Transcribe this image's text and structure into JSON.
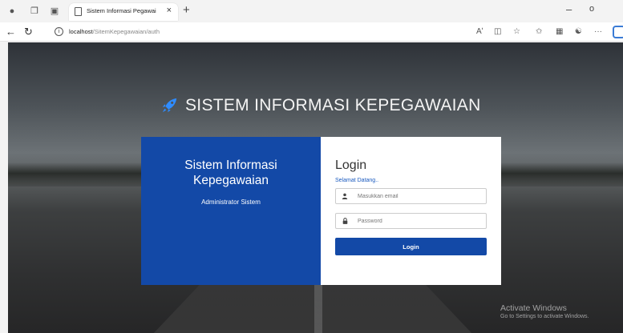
{
  "browser": {
    "tab_title": "Sistem Informasi Pegawai",
    "tab_close": "×",
    "new_tab": "+",
    "url_host": "localhost",
    "url_path": "/SitemKepegawaian/auth",
    "window_minimize": "–",
    "window_maximize": "o",
    "toolbar_more": "···",
    "read_aloud": "Aʹ"
  },
  "page": {
    "heading": "SISTEM INFORMASI KEPEGAWAIAN",
    "left_panel": {
      "title_line1": "Sistem Informasi",
      "title_line2": "Kepegawaian",
      "subtitle": "Administrator Sistem"
    },
    "login": {
      "title": "Login",
      "welcome": "Selamat Datang..",
      "email_placeholder": "Masukkan email",
      "password_placeholder": "Password",
      "button_label": "Login"
    },
    "accent_color": "#1349a7"
  },
  "watermark": {
    "line1": "Activate Windows",
    "line2": "Go to Settings to activate Windows."
  }
}
